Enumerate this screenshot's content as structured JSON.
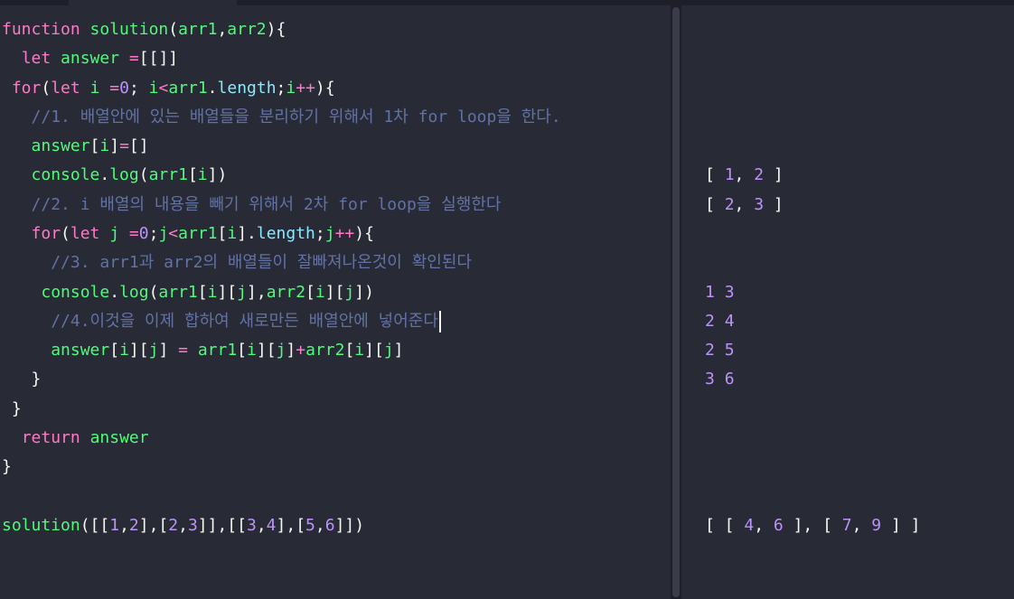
{
  "colors": {
    "background": "#282a36",
    "keyword": "#ff79c6",
    "function": "#50fa7b",
    "property": "#8be9fd",
    "number": "#bd93f9",
    "comment": "#6272a4",
    "text": "#f8f8f2"
  },
  "editor": {
    "lines": [
      [
        [
          "kw",
          "function"
        ],
        [
          "pl",
          " "
        ],
        [
          "fn",
          "solution"
        ],
        [
          "pl",
          "("
        ],
        [
          "fn",
          "arr1"
        ],
        [
          "pl",
          ","
        ],
        [
          "fn",
          "arr2"
        ],
        [
          "pl",
          "){"
        ]
      ],
      [
        [
          "pl",
          "  "
        ],
        [
          "kw",
          "let"
        ],
        [
          "pl",
          " "
        ],
        [
          "fn",
          "answer"
        ],
        [
          "pl",
          " "
        ],
        [
          "kw",
          "="
        ],
        [
          "pl",
          "[[]]"
        ]
      ],
      [
        [
          "pl",
          " "
        ],
        [
          "kw",
          "for"
        ],
        [
          "pl",
          "("
        ],
        [
          "kw",
          "let"
        ],
        [
          "pl",
          " "
        ],
        [
          "fn",
          "i"
        ],
        [
          "pl",
          " "
        ],
        [
          "kw",
          "="
        ],
        [
          "num",
          "0"
        ],
        [
          "pl",
          "; "
        ],
        [
          "fn",
          "i"
        ],
        [
          "kw",
          "<"
        ],
        [
          "fn",
          "arr1"
        ],
        [
          "pl",
          "."
        ],
        [
          "prop",
          "length"
        ],
        [
          "pl",
          ";"
        ],
        [
          "fn",
          "i"
        ],
        [
          "kw",
          "++"
        ],
        [
          "pl",
          "){"
        ]
      ],
      [
        [
          "pl",
          "   "
        ],
        [
          "cm",
          "//1. 배열안에 있는 배열들을 분리하기 위해서 1차 for loop을 한다."
        ]
      ],
      [
        [
          "pl",
          "   "
        ],
        [
          "fn",
          "answer"
        ],
        [
          "pl",
          "["
        ],
        [
          "fn",
          "i"
        ],
        [
          "pl",
          "]"
        ],
        [
          "kw",
          "="
        ],
        [
          "pl",
          "[]"
        ]
      ],
      [
        [
          "pl",
          "   "
        ],
        [
          "fn",
          "console"
        ],
        [
          "pl",
          "."
        ],
        [
          "fn",
          "log"
        ],
        [
          "pl",
          "("
        ],
        [
          "fn",
          "arr1"
        ],
        [
          "pl",
          "["
        ],
        [
          "fn",
          "i"
        ],
        [
          "pl",
          "])"
        ]
      ],
      [
        [
          "pl",
          "   "
        ],
        [
          "cm",
          "//2. i 배열의 내용을 빼기 위해서 2차 for loop을 실행한다"
        ]
      ],
      [
        [
          "pl",
          "   "
        ],
        [
          "kw",
          "for"
        ],
        [
          "pl",
          "("
        ],
        [
          "kw",
          "let"
        ],
        [
          "pl",
          " "
        ],
        [
          "fn",
          "j"
        ],
        [
          "pl",
          " "
        ],
        [
          "kw",
          "="
        ],
        [
          "num",
          "0"
        ],
        [
          "pl",
          ";"
        ],
        [
          "fn",
          "j"
        ],
        [
          "kw",
          "<"
        ],
        [
          "fn",
          "arr1"
        ],
        [
          "pl",
          "["
        ],
        [
          "fn",
          "i"
        ],
        [
          "pl",
          "]."
        ],
        [
          "prop",
          "length"
        ],
        [
          "pl",
          ";"
        ],
        [
          "fn",
          "j"
        ],
        [
          "kw",
          "++"
        ],
        [
          "pl",
          "){"
        ]
      ],
      [
        [
          "pl",
          "     "
        ],
        [
          "cm",
          "//3. arr1과 arr2의 배열들이 잘빠져나온것이 확인된다"
        ]
      ],
      [
        [
          "pl",
          "    "
        ],
        [
          "fn",
          "console"
        ],
        [
          "pl",
          "."
        ],
        [
          "fn",
          "log"
        ],
        [
          "pl",
          "("
        ],
        [
          "fn",
          "arr1"
        ],
        [
          "pl",
          "["
        ],
        [
          "fn",
          "i"
        ],
        [
          "pl",
          "]["
        ],
        [
          "fn",
          "j"
        ],
        [
          "pl",
          "],"
        ],
        [
          "fn",
          "arr2"
        ],
        [
          "pl",
          "["
        ],
        [
          "fn",
          "i"
        ],
        [
          "pl",
          "]["
        ],
        [
          "fn",
          "j"
        ],
        [
          "pl",
          "])"
        ]
      ],
      [
        [
          "pl",
          "     "
        ],
        [
          "cm",
          "//4.이것을 이제 합하여 새로만든 배열안에 넣어준다"
        ]
      ],
      [
        [
          "pl",
          "     "
        ],
        [
          "fn",
          "answer"
        ],
        [
          "pl",
          "["
        ],
        [
          "fn",
          "i"
        ],
        [
          "pl",
          "]["
        ],
        [
          "fn",
          "j"
        ],
        [
          "pl",
          "] "
        ],
        [
          "kw",
          "="
        ],
        [
          "pl",
          " "
        ],
        [
          "fn",
          "arr1"
        ],
        [
          "pl",
          "["
        ],
        [
          "fn",
          "i"
        ],
        [
          "pl",
          "]["
        ],
        [
          "fn",
          "j"
        ],
        [
          "pl",
          "]"
        ],
        [
          "kw",
          "+"
        ],
        [
          "fn",
          "arr2"
        ],
        [
          "pl",
          "["
        ],
        [
          "fn",
          "i"
        ],
        [
          "pl",
          "]["
        ],
        [
          "fn",
          "j"
        ],
        [
          "pl",
          "]"
        ]
      ],
      [
        [
          "pl",
          "   }"
        ]
      ],
      [
        [
          "pl",
          " }"
        ]
      ],
      [
        [
          "pl",
          "  "
        ],
        [
          "kw",
          "return"
        ],
        [
          "pl",
          " "
        ],
        [
          "fn",
          "answer"
        ]
      ],
      [
        [
          "pl",
          "}"
        ]
      ],
      [],
      [
        [
          "fn",
          "solution"
        ],
        [
          "pl",
          "([["
        ],
        [
          "num",
          "1"
        ],
        [
          "pl",
          ","
        ],
        [
          "num",
          "2"
        ],
        [
          "pl",
          "],["
        ],
        [
          "num",
          "2"
        ],
        [
          "pl",
          ","
        ],
        [
          "num",
          "3"
        ],
        [
          "pl",
          "]],[["
        ],
        [
          "num",
          "3"
        ],
        [
          "pl",
          ","
        ],
        [
          "num",
          "4"
        ],
        [
          "pl",
          "],["
        ],
        [
          "num",
          "5"
        ],
        [
          "pl",
          ","
        ],
        [
          "num",
          "6"
        ],
        [
          "pl",
          "]])"
        ]
      ]
    ]
  },
  "output": {
    "lines": [
      [],
      [],
      [],
      [],
      [],
      [
        [
          "pl",
          "[ "
        ],
        [
          "num",
          "1"
        ],
        [
          "pl",
          ", "
        ],
        [
          "num",
          "2"
        ],
        [
          "pl",
          " ]"
        ]
      ],
      [
        [
          "pl",
          "[ "
        ],
        [
          "num",
          "2"
        ],
        [
          "pl",
          ", "
        ],
        [
          "num",
          "3"
        ],
        [
          "pl",
          " ]"
        ]
      ],
      [],
      [],
      [
        [
          "num",
          "1"
        ],
        [
          "pl",
          " "
        ],
        [
          "num",
          "3"
        ]
      ],
      [
        [
          "num",
          "2"
        ],
        [
          "pl",
          " "
        ],
        [
          "num",
          "4"
        ]
      ],
      [
        [
          "num",
          "2"
        ],
        [
          "pl",
          " "
        ],
        [
          "num",
          "5"
        ]
      ],
      [
        [
          "num",
          "3"
        ],
        [
          "pl",
          " "
        ],
        [
          "num",
          "6"
        ]
      ],
      [],
      [],
      [],
      [],
      [
        [
          "pl",
          "[ [ "
        ],
        [
          "num",
          "4"
        ],
        [
          "pl",
          ", "
        ],
        [
          "num",
          "6"
        ],
        [
          "pl",
          " ], [ "
        ],
        [
          "num",
          "7"
        ],
        [
          "pl",
          ", "
        ],
        [
          "num",
          "9"
        ],
        [
          "pl",
          " ] ]"
        ]
      ]
    ]
  }
}
